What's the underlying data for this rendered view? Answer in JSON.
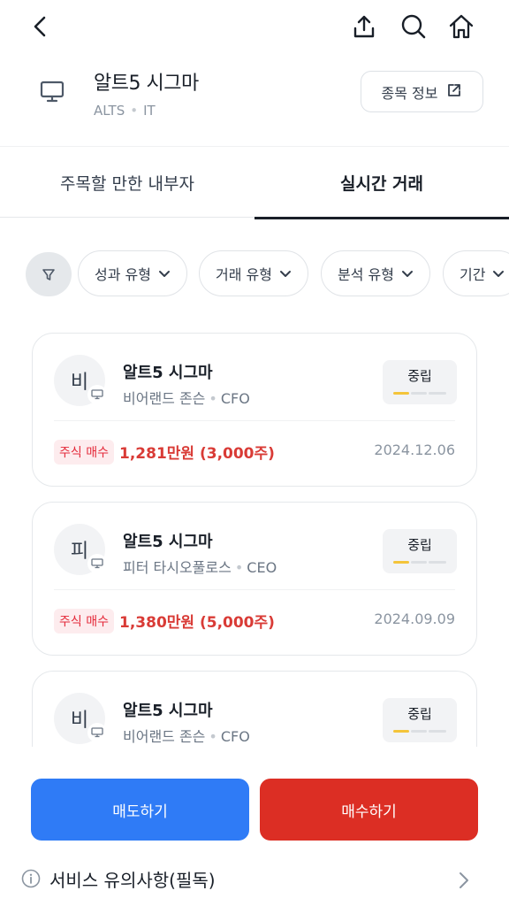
{
  "header": {
    "back_icon": "back-arrow-icon",
    "share_icon": "share-icon",
    "search_icon": "search-icon",
    "home_icon": "home-icon"
  },
  "stock": {
    "name": "알트5 시그마",
    "ticker": "ALTS",
    "sector": "IT",
    "icon": "monitor-icon",
    "info_button_label": "종목 정보",
    "info_button_icon": "external-link-icon"
  },
  "tabs": [
    {
      "label": "주목할 만한 내부자",
      "active": false
    },
    {
      "label": "실시간 거래",
      "active": true
    }
  ],
  "filters": {
    "icon": "filter-icon",
    "chips": [
      {
        "label": "성과 유형"
      },
      {
        "label": "거래 유형"
      },
      {
        "label": "분석 유형"
      },
      {
        "label": "기간"
      }
    ]
  },
  "trades": [
    {
      "avatar_initial": "비",
      "stock_name": "알트5 시그마",
      "insider_name": "비어랜드 존슨",
      "role": "CFO",
      "sentiment": "중립",
      "trade_type": "주식 매수",
      "amount": "1,281만원 (3,000주)",
      "date": "2024.12.06"
    },
    {
      "avatar_initial": "피",
      "stock_name": "알트5 시그마",
      "insider_name": "피터 타시오풀로스",
      "role": "CEO",
      "sentiment": "중립",
      "trade_type": "주식 매수",
      "amount": "1,380만원 (5,000주)",
      "date": "2024.09.09"
    },
    {
      "avatar_initial": "비",
      "stock_name": "알트5 시그마",
      "insider_name": "비어랜드 존슨",
      "role": "CFO",
      "sentiment": "중립",
      "trade_type": "",
      "amount": "",
      "date": ""
    }
  ],
  "actions": {
    "sell_label": "매도하기",
    "buy_label": "매수하기"
  },
  "notice": {
    "label": "서비스 유의사항(필독)",
    "icon": "info-icon"
  },
  "colors": {
    "sell": "#2f7bf6",
    "buy": "#dc2e24",
    "sentiment_accent": "#f4c43a",
    "price_red": "#d93b36"
  }
}
